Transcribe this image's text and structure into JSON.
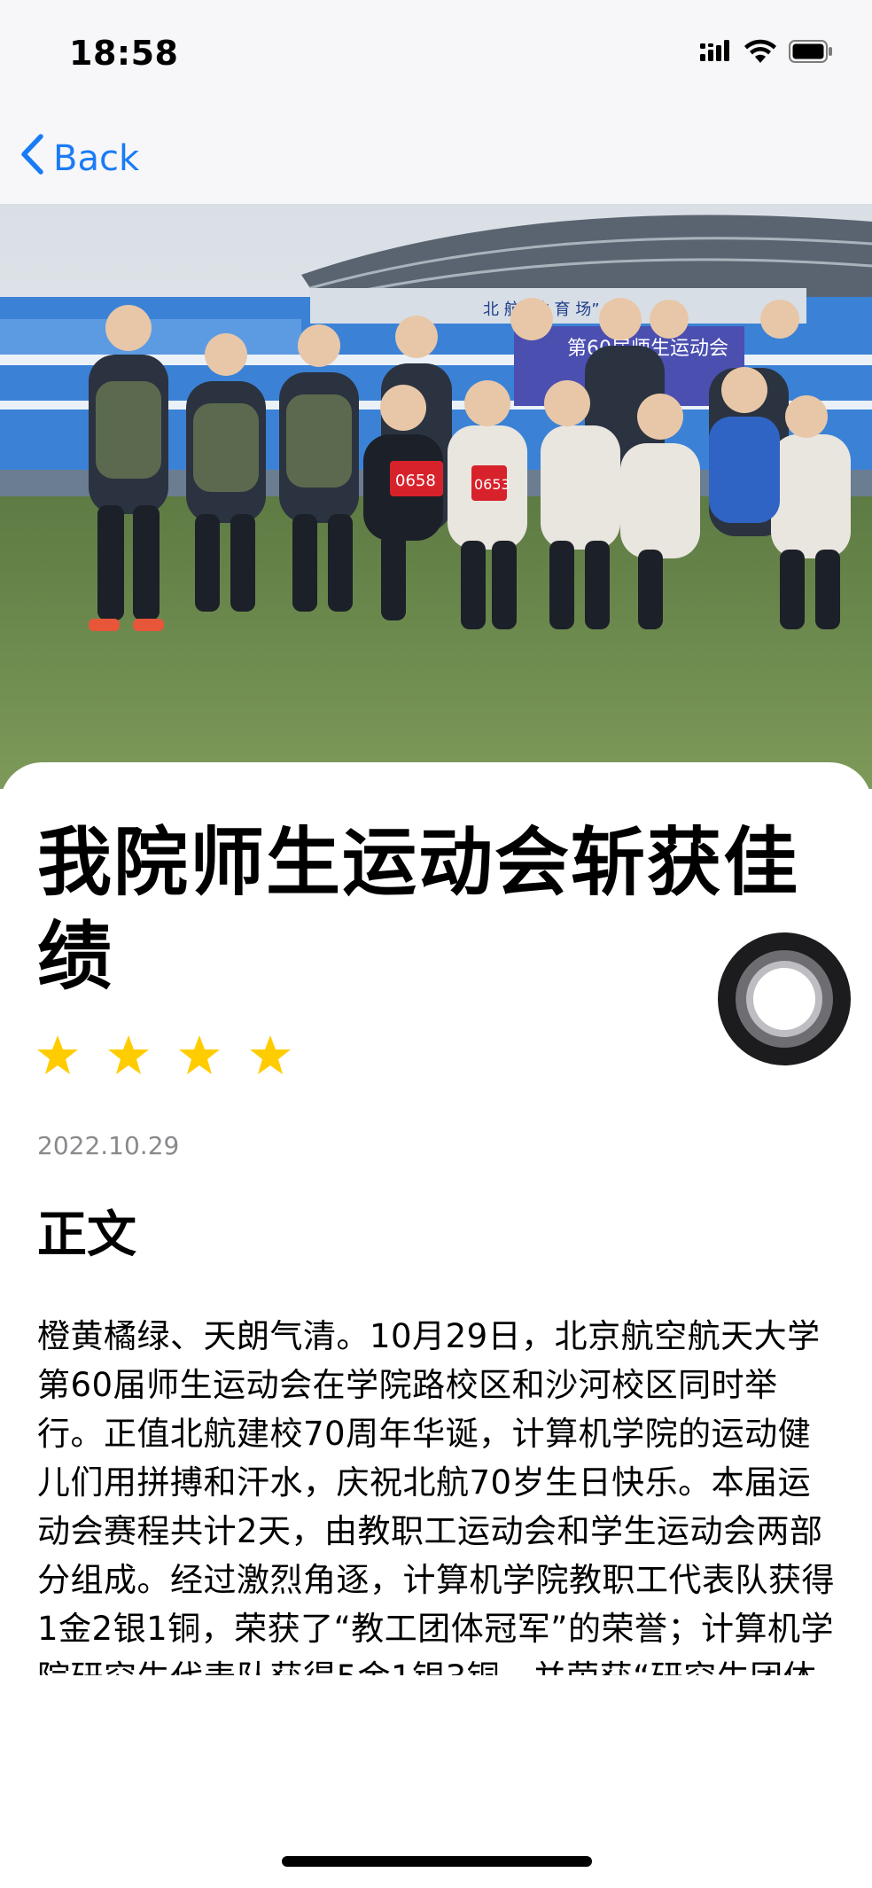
{
  "status_bar": {
    "time": "18:58"
  },
  "nav": {
    "back_label": "Back"
  },
  "hero": {
    "stadium_sign": "北 航 “体 育 场”",
    "banner_text": "第60届师生运动会",
    "bib_numbers": [
      "0658",
      "0653"
    ]
  },
  "article": {
    "title": "我院师生运动会斩获佳绩",
    "rating_stars": 4,
    "rating_max": 4,
    "date": "2022.10.29",
    "section_heading": "正文",
    "body": "橙黄橘绿、天朗气清。10月29日，北京航空航天大学第60届师生运动会在学院路校区和沙河校区同时举行。正值北航建校70周年华诞，计算机学院的运动健儿们用拼搏和汗水，庆祝北航70岁生日快乐。本届运动会赛程共计2天，由教职工运动会和学生运动会两部分组成。经过激烈角逐，计算机学院教职工代表队获得1金2银1铜，荣获了“教工团体冠军”的荣誉；计算机学院研究生代表队获得5金1银3铜，并荣获“研究生团体第四名”；同时，我院师生获得"
  },
  "colors": {
    "accent": "#1a7cf5",
    "star": "#ffcc00",
    "date_gray": "#8a8a8e",
    "nav_background": "#f7f7f9"
  }
}
